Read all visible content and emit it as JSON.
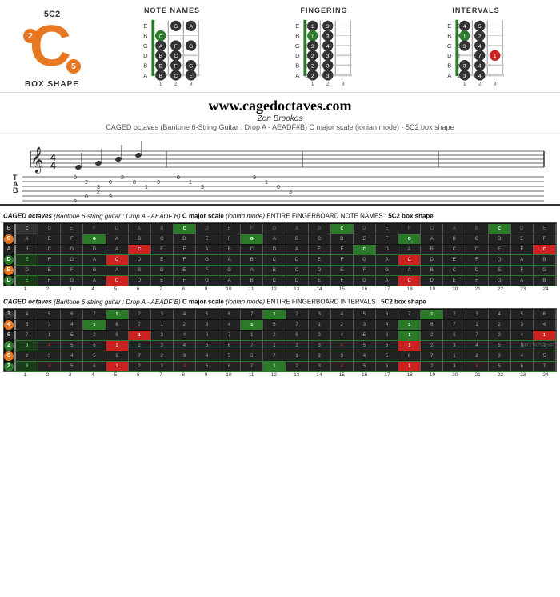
{
  "header": {
    "shape_id": "5C2",
    "shape_name": "BOX SHAPE",
    "badge_2": "2",
    "badge_5": "5",
    "c_letter": "C"
  },
  "diagram_titles": {
    "note_names": "NOTE NAMES",
    "fingering": "FINGERING",
    "intervals": "INTERVALS"
  },
  "website": {
    "url": "www.cagedoctaves.com",
    "author": "Zon Brookes",
    "description": "CAGED octaves (Baritone 6-String Guitar : Drop A - AEADF#B) C major scale (ionian mode) - 5C2 box shape"
  },
  "fb1_title": "CAGED octaves (Baritone 6-string guitar : Drop A - AEADFᴼB) C major scale (ionian mode) ENTIRE FINGERBOARD NOTE NAMES : 5C2 box shape",
  "fb2_title": "CAGED octaves (Baritone 6-string guitar : Drop A - AEADFᴼB) C major scale (ionian mode) ENTIRE FINGERBOARD INTERVALS : 5C2 box shape",
  "fret_numbers_24": [
    "1",
    "2",
    "3",
    "4",
    "5",
    "6",
    "7",
    "8",
    "9",
    "10",
    "11",
    "12",
    "13",
    "14",
    "15",
    "16",
    "17",
    "18",
    "19",
    "20",
    "21",
    "22",
    "23",
    "24"
  ],
  "box_shape_label": "box shape"
}
